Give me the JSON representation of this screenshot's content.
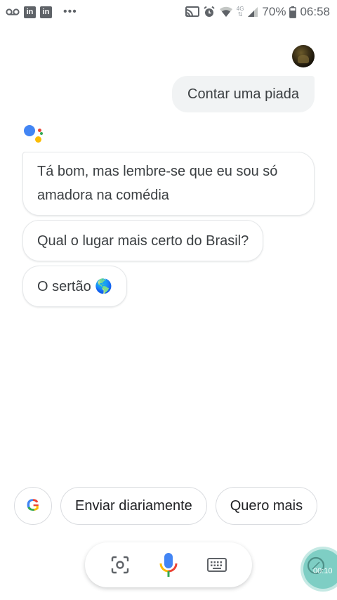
{
  "status_bar": {
    "icons_left": [
      "voicemail-icon",
      "linkedin-icon",
      "linkedin-icon",
      "more-dots-icon"
    ],
    "linkedin_text": "in",
    "more": "•••",
    "icons_right": [
      "cast-icon",
      "alarm-icon",
      "wifi-icon",
      "network-4g-icon",
      "signal-icon",
      "battery-icon"
    ],
    "network_label": "4G",
    "battery": "70%",
    "time": "06:58"
  },
  "conversation": {
    "user_message": "Contar uma piada",
    "assistant_messages": [
      "Tá bom, mas lembre-se que eu sou só amadora na comédia",
      "Qual o lugar mais certo do Brasil?",
      "O sertão 🌎"
    ]
  },
  "suggestions": {
    "google_icon": "G",
    "chips": [
      "Enviar diariamente",
      "Quero mais"
    ]
  },
  "input_bar": {
    "buttons": [
      "lens-icon",
      "mic-icon",
      "keyboard-icon"
    ]
  },
  "recorder": {
    "time": "00:10"
  },
  "colors": {
    "google_blue": "#4285f4",
    "google_red": "#ea4335",
    "google_yellow": "#fbbc05",
    "google_green": "#34a853",
    "bubble_grey": "#f1f3f4",
    "recorder_teal": "#7ecec4"
  }
}
